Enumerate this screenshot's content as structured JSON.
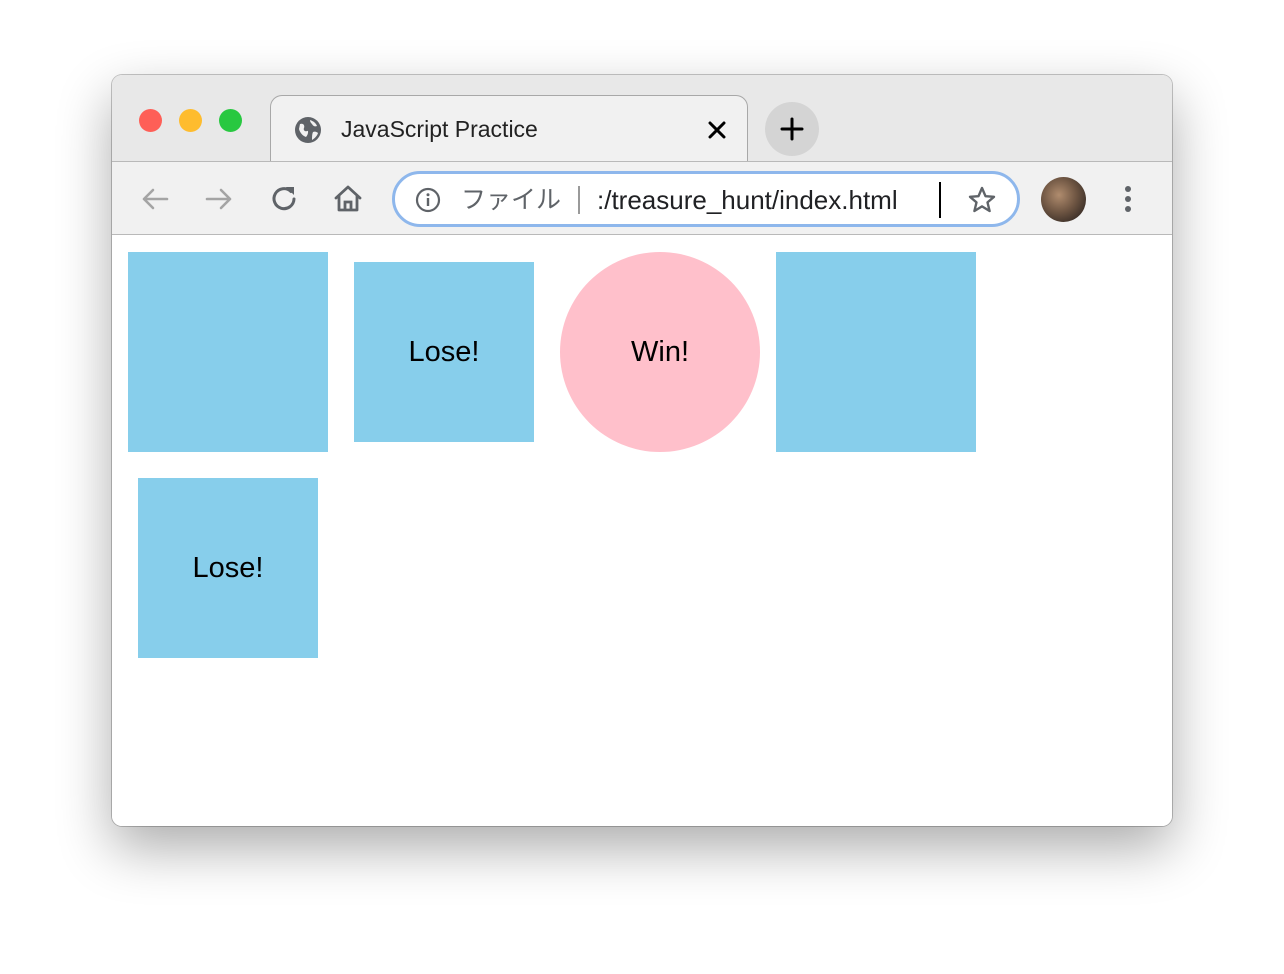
{
  "tab": {
    "title": "JavaScript Practice",
    "favicon": "globe-icon",
    "close_icon": "close-icon"
  },
  "new_tab_icon": "plus-icon",
  "toolbar": {
    "back_icon": "back-arrow-icon",
    "forward_icon": "forward-arrow-icon",
    "reload_icon": "reload-icon",
    "home_icon": "home-icon",
    "menu_icon": "more-vert-icon"
  },
  "omnibox": {
    "info_icon": "info-icon",
    "scheme_label": "ファイル",
    "url": ":/treasure_hunt/index.html",
    "bookmark_icon": "star-icon"
  },
  "page": {
    "cards": [
      {
        "label": "",
        "shape": "square",
        "color": "#87ceeb"
      },
      {
        "label": "Lose!",
        "shape": "square",
        "color": "#87ceeb"
      },
      {
        "label": "Win!",
        "shape": "circle",
        "color": "#ffc0cb"
      },
      {
        "label": "",
        "shape": "square",
        "color": "#87ceeb"
      },
      {
        "label": "Lose!",
        "shape": "square",
        "color": "#87ceeb"
      }
    ]
  },
  "colors": {
    "omnibox_focus": "#8eb7ec",
    "traffic_close": "#fe5f57",
    "traffic_minimize": "#febc2e",
    "traffic_maximize": "#28c840"
  }
}
